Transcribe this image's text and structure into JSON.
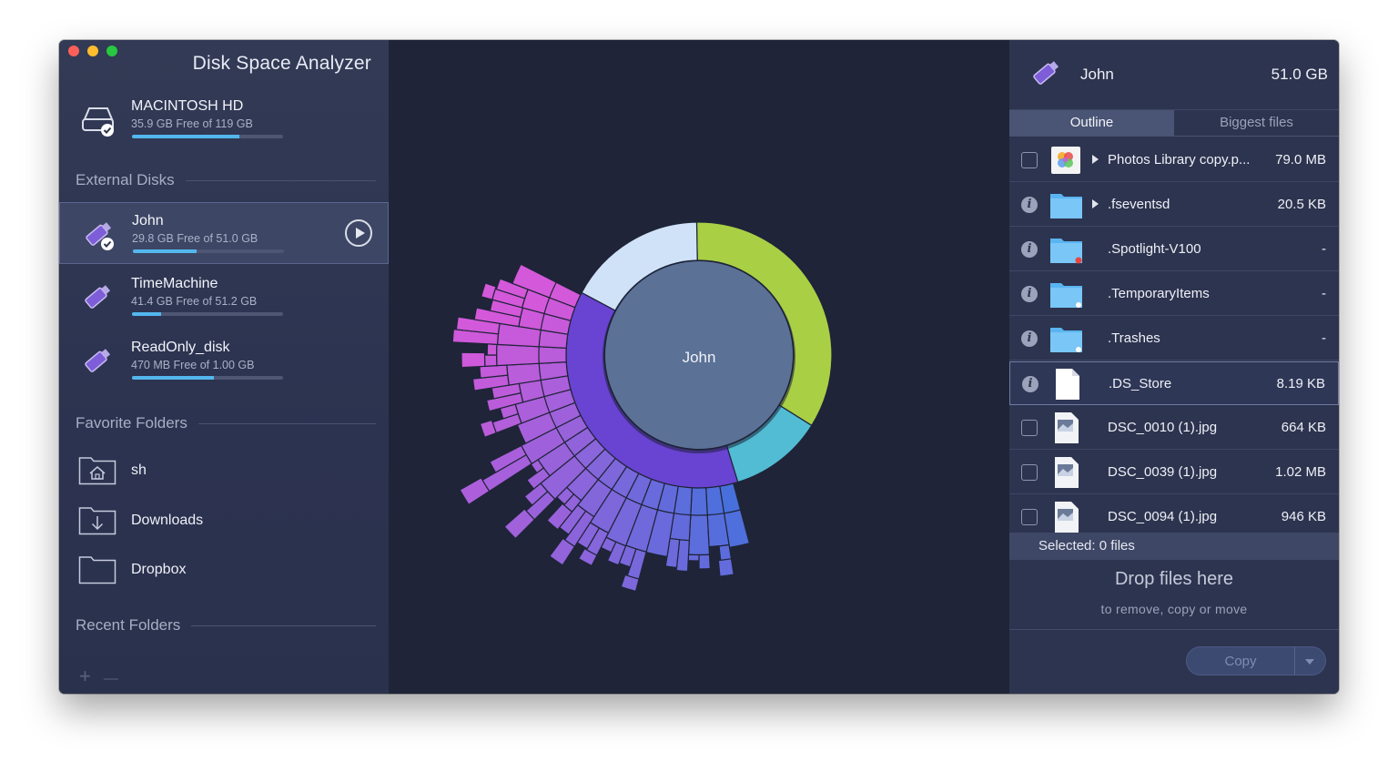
{
  "app": {
    "title": "Disk Space Analyzer"
  },
  "internal_disk": {
    "name": "MACINTOSH HD",
    "free": "35.9 GB Free of 119 GB",
    "used_fraction": 0.71
  },
  "sections": {
    "external": "External Disks",
    "favorites": "Favorite Folders",
    "recent": "Recent Folders"
  },
  "external_disks": [
    {
      "name": "John",
      "free": "29.8 GB Free of 51.0 GB",
      "used_fraction": 0.42,
      "selected": true
    },
    {
      "name": "TimeMachine",
      "free": "41.4 GB Free of 51.2 GB",
      "used_fraction": 0.19
    },
    {
      "name": "ReadOnly_disk",
      "free": "470 MB Free of 1.00 GB",
      "used_fraction": 0.54
    }
  ],
  "favorite_folders": [
    {
      "name": "sh",
      "icon": "home-folder-icon"
    },
    {
      "name": "Downloads",
      "icon": "downloads-folder-icon"
    },
    {
      "name": "Dropbox",
      "icon": "folder-icon"
    }
  ],
  "recent_controls": {
    "add": "+",
    "remove": "—"
  },
  "chart": {
    "center_label": "John"
  },
  "right_panel": {
    "disk_name": "John",
    "disk_size": "51.0 GB",
    "tabs": [
      {
        "label": "Outline",
        "active": true
      },
      {
        "label": "Biggest files",
        "active": false
      }
    ],
    "files": [
      {
        "name": "Photos Library copy.p...",
        "size": "79.0 MB",
        "control": "checkbox",
        "icon": "photos-icon",
        "expandable": true
      },
      {
        "name": ".fseventsd",
        "size": "20.5 KB",
        "control": "info",
        "icon": "folder-icon",
        "expandable": true
      },
      {
        "name": ".Spotlight-V100",
        "size": "-",
        "control": "info",
        "icon": "folder-icon",
        "expandable": false
      },
      {
        "name": ".TemporaryItems",
        "size": "-",
        "control": "info",
        "icon": "folder-icon",
        "expandable": false
      },
      {
        "name": ".Trashes",
        "size": "-",
        "control": "info",
        "icon": "folder-icon",
        "expandable": false
      },
      {
        "name": ".DS_Store",
        "size": "8.19 KB",
        "control": "info",
        "icon": "document-icon",
        "expandable": false,
        "selected": true
      },
      {
        "name": "DSC_0010 (1).jpg",
        "size": "664 KB",
        "control": "checkbox",
        "icon": "jpeg-icon",
        "expandable": false
      },
      {
        "name": "DSC_0039 (1).jpg",
        "size": "1.02 MB",
        "control": "checkbox",
        "icon": "jpeg-icon",
        "expandable": false
      },
      {
        "name": "DSC_0094 (1).jpg",
        "size": "946 KB",
        "control": "checkbox",
        "icon": "jpeg-icon",
        "expandable": false
      }
    ],
    "selected_text": "Selected: 0 files",
    "drop_title": "Drop files here",
    "drop_subtitle": "to remove, copy or move",
    "copy_label": "Copy",
    "info_glyph": "i"
  }
}
